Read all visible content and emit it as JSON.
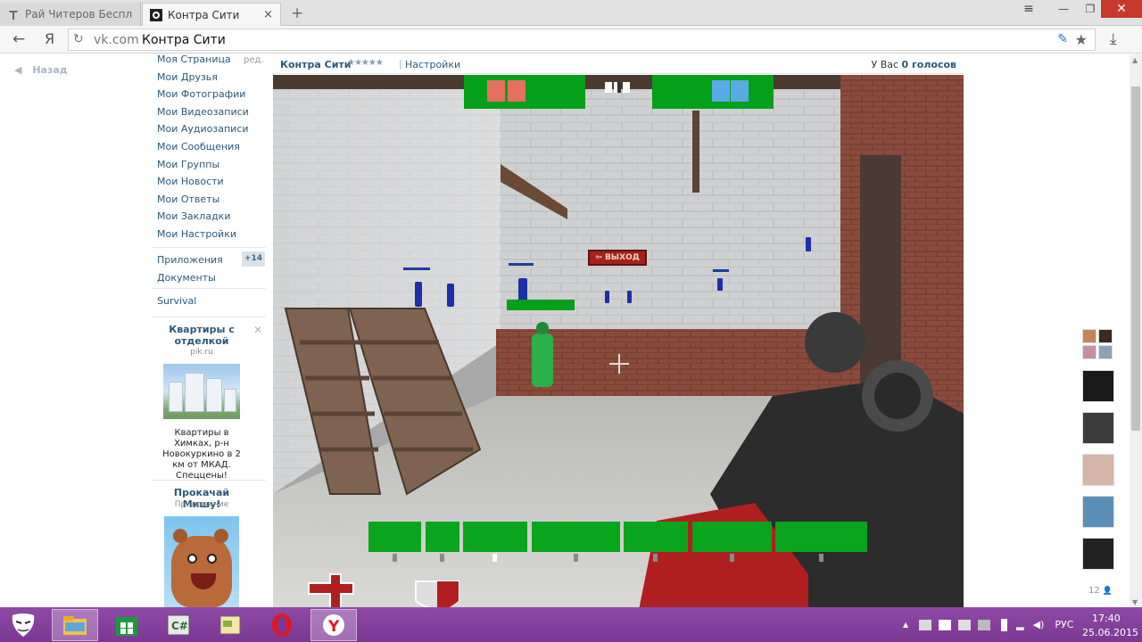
{
  "browser": {
    "tabs": [
      {
        "title": "Рай Читеров Бесплат",
        "active": false
      },
      {
        "title": "Контра Сити",
        "active": true
      }
    ],
    "new_tab_icon": "+",
    "window_controls": {
      "menu": "≡",
      "minimize": "—",
      "restore": "❐",
      "close": "✕"
    },
    "nav": {
      "back_icon": "←",
      "yandex_icon": "Я"
    },
    "address": {
      "domain": "vk.com",
      "title": "Контра Сити"
    },
    "icons": {
      "reload": "↻",
      "brush": "✎",
      "star": "★",
      "download": "⤓"
    }
  },
  "vk": {
    "back_link": "Назад",
    "back_icon": "◀",
    "edit_link": "ред.",
    "menu": [
      "Моя Страница",
      "Мои Друзья",
      "Мои Фотографии",
      "Мои Видеозаписи",
      "Мои Аудиозаписи",
      "Мои Сообщения",
      "Мои Группы",
      "Мои Новости",
      "Мои Ответы",
      "Мои Закладки",
      "Мои Настройки"
    ],
    "apps_link": "Приложения",
    "apps_count": "+14",
    "docs_link": "Документы",
    "survival_link": "Survival",
    "ad": {
      "title": "Квартиры с отделкой",
      "close_icon": "✕",
      "domain": "pik.ru",
      "text": "Квартиры в Химках, р-н Новокуркино в 2 км от МКАД. Спеццены!"
    },
    "ad2": {
      "title": "Прокачай Мишу!",
      "subtitle": "Приложение"
    }
  },
  "app": {
    "name": "Контра Сити",
    "stars": "★★★★★",
    "divider": "|",
    "settings": "Настройки",
    "votes_prefix": "У Вас",
    "votes_value": "0 голосов"
  },
  "game": {
    "exit_sign": "⇦ ВЫХОД",
    "team_red_color": "#e5705e",
    "team_blue_color": "#5aaae5",
    "hud_green": "#09a51d"
  },
  "sidebar": {
    "online_count": "12",
    "person_icon": "👤"
  },
  "taskbar": {
    "lang": "РУС",
    "time": "17:40",
    "date": "25.06.2015",
    "tray_up_icon": "▲"
  }
}
